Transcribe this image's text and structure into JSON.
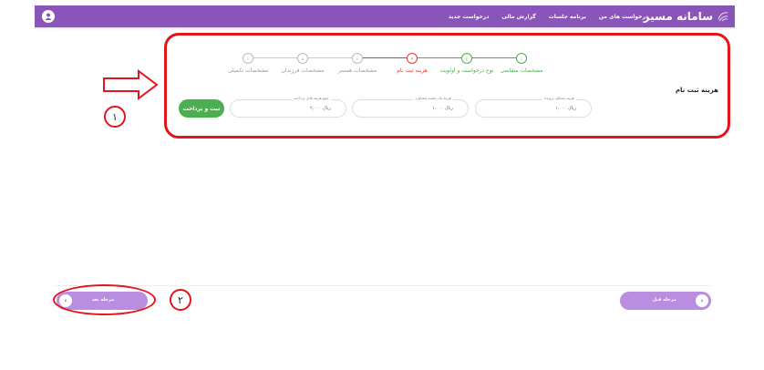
{
  "header": {
    "brand": "سامانه مسیر",
    "nav": [
      "درخواست های من",
      "برنامه جلسات",
      "گزارش مالی",
      "درخواست جدید"
    ]
  },
  "stepper": {
    "steps": [
      {
        "num": "۱",
        "label": "مشخصات متقاضی",
        "state": "done"
      },
      {
        "num": "۲",
        "label": "نوع درخواست و اولویت",
        "state": "done"
      },
      {
        "num": "۳",
        "label": "هزینه ثبت نام",
        "state": "active"
      },
      {
        "num": "۴",
        "label": "مشخصات همسر",
        "state": "pending"
      },
      {
        "num": "۵",
        "label": "مشخصات فرزندان",
        "state": "pending"
      },
      {
        "num": "۶",
        "label": "مشخصات تکمیلی",
        "state": "pending"
      }
    ]
  },
  "registration": {
    "title": "هزینه ثبت نام",
    "fields": [
      {
        "label": "هزینه تشکیل پرونده",
        "value": "۱,۰۰۰ ریال"
      },
      {
        "label": "هزینه یک جلسه مشاوره",
        "value": "۱,۰۰۰ ریال"
      },
      {
        "label": "جمع هزینه قابل پرداخت",
        "value": "۲,۰۰۰ ریال"
      }
    ],
    "pay_button": "ثبت و پرداخت"
  },
  "footer": {
    "prev_label": "مرحله قبل",
    "next_label": "مرحله بعد"
  },
  "annotations": {
    "one": "۱",
    "two": "۲"
  },
  "colors": {
    "header": "#8a55b8",
    "done": "#4bae4f",
    "active": "#e53935",
    "pending": "#aaaaaa",
    "annotation": "#e3141b"
  }
}
